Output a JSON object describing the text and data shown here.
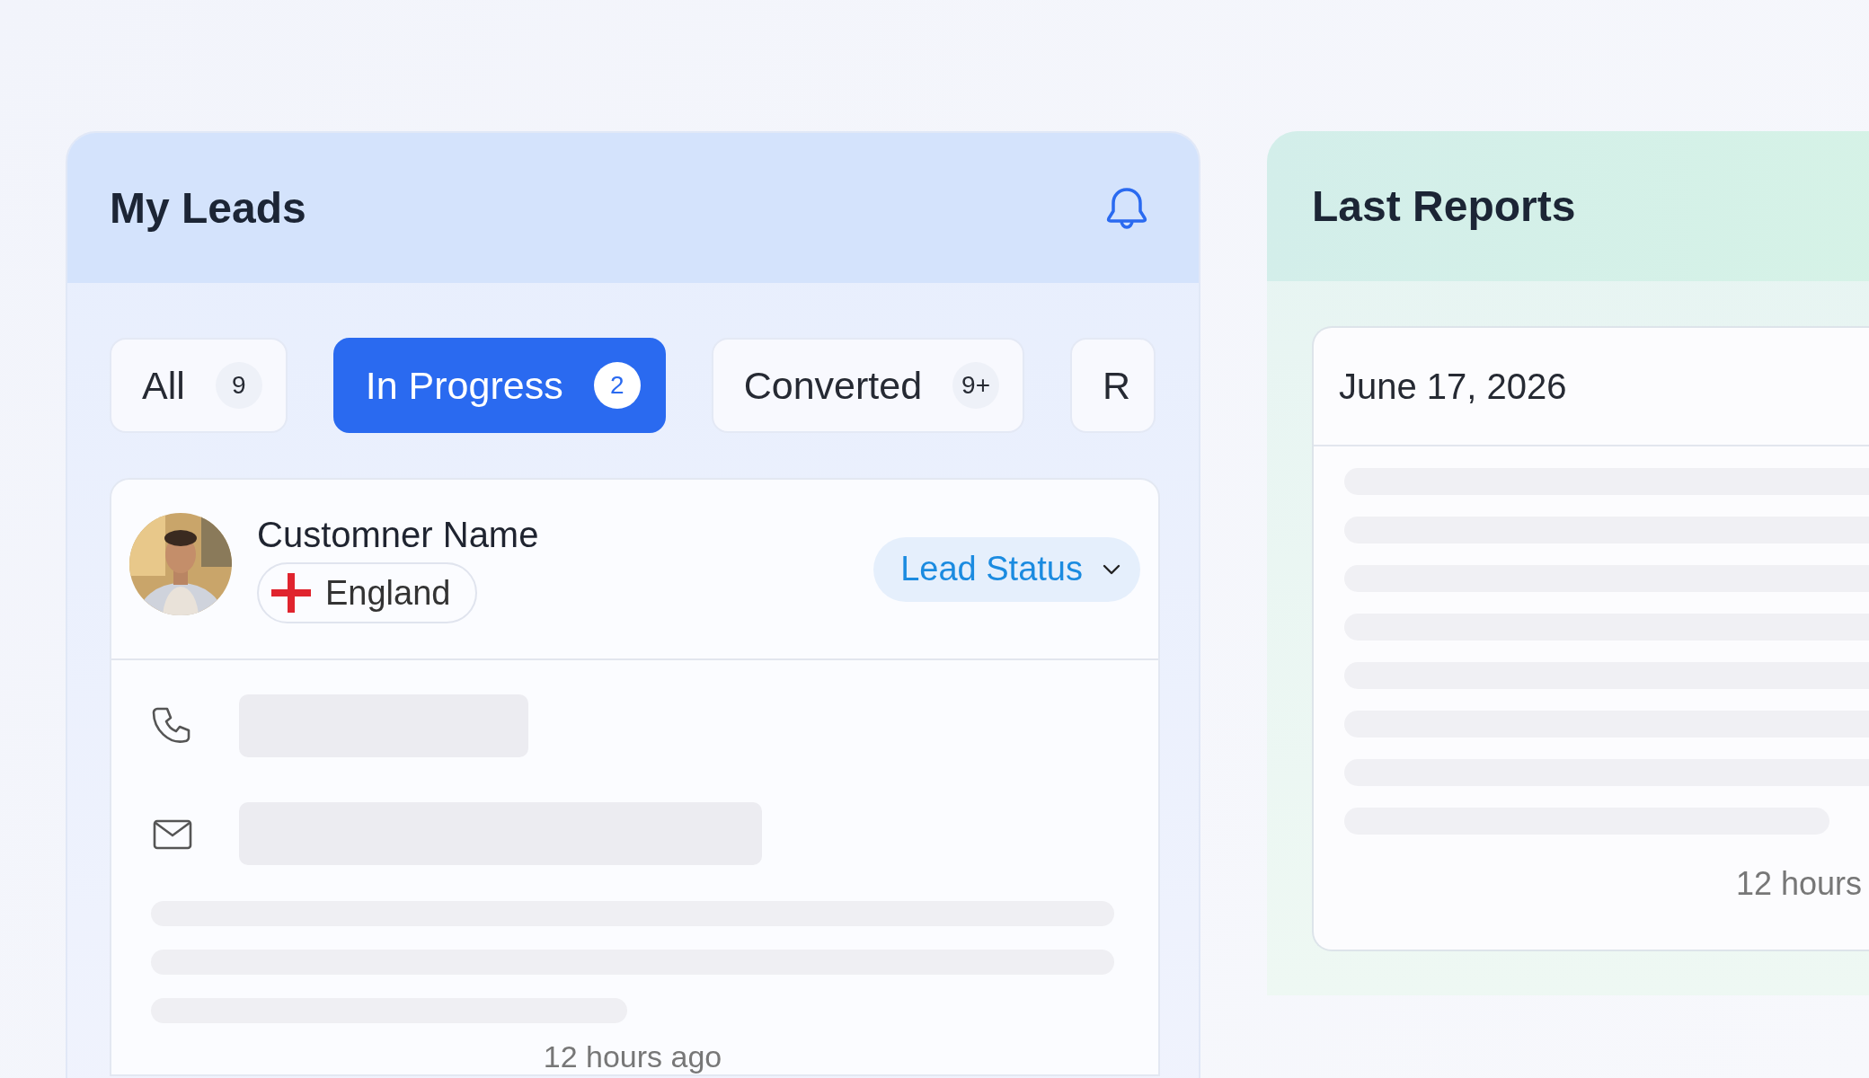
{
  "leads_panel": {
    "title": "My Leads",
    "tabs": [
      {
        "label": "All",
        "count": "9",
        "selected": false
      },
      {
        "label": "In Progress",
        "count": "2",
        "selected": true
      },
      {
        "label": "Converted",
        "count": "9+",
        "selected": false
      },
      {
        "label": "R",
        "selected": false
      }
    ],
    "lead_card": {
      "customer_name": "Customner Name",
      "country": "England",
      "status_button": "Lead Status",
      "footer": "12 hours ago"
    }
  },
  "reports_panel": {
    "title": "Last Reports",
    "report_card": {
      "date": "June 17, 2026",
      "footer": "12 hours"
    }
  }
}
